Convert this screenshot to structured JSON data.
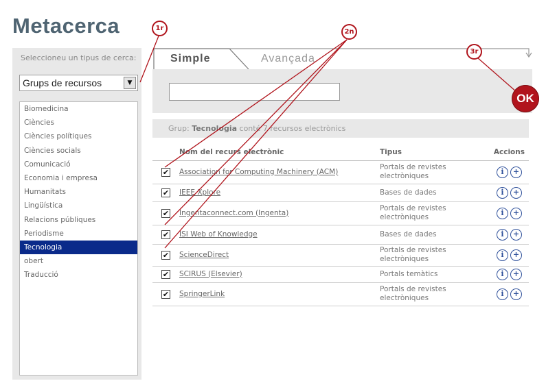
{
  "app_title": "Metacerca",
  "sidebar": {
    "prompt": "Seleccioneu un tipus de cerca:",
    "select_value": "Grups de recursos",
    "items": [
      {
        "label": "Biomedicina"
      },
      {
        "label": "Ciències"
      },
      {
        "label": "Ciències polítiques"
      },
      {
        "label": "Ciències socials"
      },
      {
        "label": "Comunicació"
      },
      {
        "label": "Economia i empresa"
      },
      {
        "label": "Humanitats"
      },
      {
        "label": "Lingüística"
      },
      {
        "label": "Relacions públiques"
      },
      {
        "label": "Periodisme"
      },
      {
        "label": "Tecnologia",
        "selected": true
      },
      {
        "label": "obert"
      },
      {
        "label": "Traducció"
      }
    ]
  },
  "tabs": {
    "simple": "Simple",
    "advanced": "Avançada"
  },
  "search": {
    "value": "",
    "placeholder": ""
  },
  "ok_button": "OK",
  "group_bar": {
    "prefix": "Grup:",
    "group": "Tecnologia",
    "suffix": "conté 7 recursos electrònics"
  },
  "table": {
    "headers": {
      "name": "Nom del recurs electrònic",
      "type": "Tipus",
      "actions": "Accions"
    },
    "rows": [
      {
        "name": "Association for Computing Machinery (ACM)",
        "type": "Portals de revistes electròniques",
        "checked": true
      },
      {
        "name": "IEEE Xplore",
        "type": "Bases de dades",
        "checked": true
      },
      {
        "name": "Ingentaconnect.com (Ingenta)",
        "type": "Portals de revistes electròniques",
        "checked": true
      },
      {
        "name": "ISI Web of Knowledge",
        "type": "Bases de dades",
        "checked": true
      },
      {
        "name": "ScienceDirect",
        "type": "Portals de revistes electròniques",
        "checked": true
      },
      {
        "name": "SCIRUS (Elsevier)",
        "type": "Portals temàtics",
        "checked": true
      },
      {
        "name": "SpringerLink",
        "type": "Portals de revistes electròniques",
        "checked": true
      }
    ]
  },
  "callouts": {
    "one": "1r",
    "two": "2n",
    "three": "3r"
  },
  "colors": {
    "accent": "#0a2a8a",
    "ok": "#b1141d",
    "callout": "#b0141c",
    "title": "#4f6472"
  },
  "icons": {
    "select_arrow": "chevron-down-icon",
    "check": "check-icon",
    "info": "info-icon",
    "add": "plus-icon"
  }
}
